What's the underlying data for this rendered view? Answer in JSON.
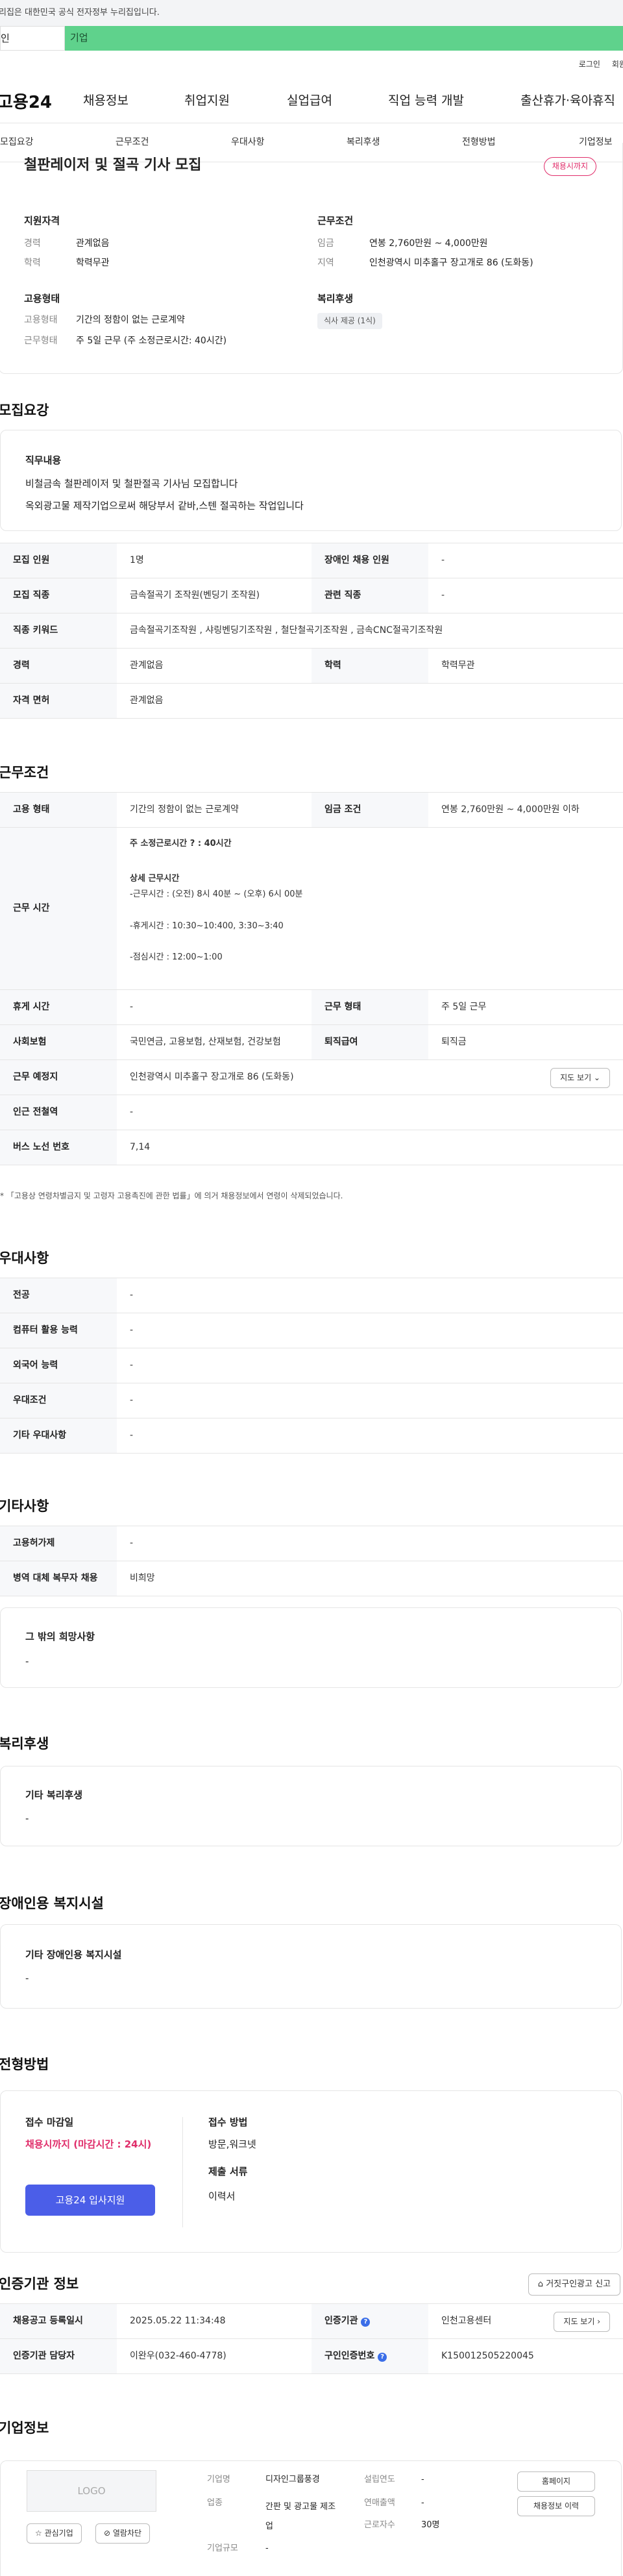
{
  "gov_notice": "리집은 대한민국 공식 전자정부 누리집입니다.",
  "site_tabs": [
    "인",
    "기업"
  ],
  "util": [
    "로그인",
    "회원가"
  ],
  "header": {
    "logo": "고용24",
    "menu": [
      "채용정보",
      "취업지원",
      "실업급여",
      "직업 능력 개발",
      "출산휴가·육아휴직"
    ]
  },
  "tabs": [
    "모집요강",
    "근무조건",
    "우대사항",
    "복리후생",
    "전형방법",
    "기업정보"
  ],
  "summary": {
    "title": "철판레이저 및 절곡 기사 모집",
    "badge": "채용시까지",
    "qual_title": "지원자격",
    "career_label": "경력",
    "career_value": "관계없음",
    "edu_label": "학력",
    "edu_value": "학력무관",
    "cond_title": "근무조건",
    "wage_label": "임금",
    "wage_value": "연봉 2,760만원 ~ 4,000만원",
    "region_label": "지역",
    "region_value": "인천광역시 미추홀구 장고개로 86 (도화동)",
    "emp_title": "고용형태",
    "emptype_label": "고용형태",
    "emptype_value": "기간의 정함이 없는 근로계약",
    "worktype_label": "근무형태",
    "worktype_value": "주 5일 근무 (주 소정근로시간: 40시간)",
    "welfare_title": "복리후생",
    "welfare_chip": "식사 제공 (1식)"
  },
  "recruit": {
    "section_title": "모집요강",
    "duty_title": "직무내용",
    "duty_line1": "비철금속 철판레이저 및 철판절곡 기사님 모집합니다",
    "duty_line2": "옥외광고물 제작기업으로써 해당부서 같바,스텐 절곡하는 작업입니다",
    "rows": [
      [
        "모집 인원",
        "1명",
        "장애인 채용 인원",
        "-"
      ],
      [
        "모집 직종",
        "금속절곡기 조작원(벤딩기 조작원)",
        "관련 직종",
        "-"
      ],
      [
        "직종 키워드",
        "금속절곡기조작원 , 샤링벤딩기조작원 , 철단철곡기조작원 , 금속CNC절곡기조작원"
      ],
      [
        "경력",
        "관계없음",
        "학력",
        "학력무관"
      ],
      [
        "자격 면허",
        "관계없음"
      ]
    ]
  },
  "conditions": {
    "section_title": "근무조건",
    "emp_type_label": "고용 형태",
    "emp_type_value": "기간의 정함이 없는 근로계약",
    "wage_label": "임금 조건",
    "wage_value": "연봉 2,760만원 ~ 4,000만원 이하",
    "hours_label": "근무 시간",
    "hours_main": "주 소정근로시간 ? : 40시간",
    "hours_detail_title": "상세 근무시간",
    "hours_line1": "-근무시간 : (오전) 8시 40분 ~ (오후) 6시 00분",
    "hours_line2": "-휴게시간 : 10:30~10:400, 3:30~3:40",
    "hours_line3": "-점심시간 : 12:00~1:00",
    "rest_label": "휴게 시간",
    "rest_value": "-",
    "worktype_label": "근무 형태",
    "worktype_value": "주 5일 근무",
    "insurance_label": "사회보험",
    "insurance_value": "국민연금, 고용보험, 산재보험, 건강보험",
    "retire_label": "퇴직급여",
    "retire_value": "퇴직금",
    "place_label": "근무 예정지",
    "place_value": "인천광역시 미추홀구 장고개로 86 (도화동)",
    "map_btn": "지도 보기 ⌄",
    "station_label": "인근 전철역",
    "station_value": "-",
    "bus_label": "버스 노선 번호",
    "bus_value": "7,14",
    "note": "* 「고용상 연령차별금지 및 고령자 고용촉진에 관한 법률」에 의거 채용정보에서 연령이 삭제되었습니다."
  },
  "preferences": {
    "section_title": "우대사항",
    "rows": [
      [
        "전공",
        "-"
      ],
      [
        "컴퓨터 활용 능력",
        "-"
      ],
      [
        "외국어 능력",
        "-"
      ],
      [
        "우대조건",
        "-"
      ],
      [
        "기타 우대사항",
        "-"
      ]
    ]
  },
  "others": {
    "section_title": "기타사항",
    "rows": [
      [
        "고용허가제",
        "-"
      ],
      [
        "병역 대체 복무자 채용",
        "비희망"
      ]
    ],
    "etc_title": "그 밖의 희망사항",
    "etc_value": "-"
  },
  "welfare": {
    "section_title": "복리후생",
    "label": "기타 복리후생",
    "value": "-"
  },
  "disabled": {
    "section_title": "장애인용 복지시설",
    "label": "기타 장애인용 복지시설",
    "value": "-"
  },
  "apply": {
    "section_title": "전형방법",
    "deadline_label": "접수 마감일",
    "deadline_value": "채용시까지 (마감시간 : 24시)",
    "button": "고용24 입사지원",
    "method_label": "접수 방법",
    "method_value": "방문,워크넷",
    "docs_label": "제출 서류",
    "docs_value": "이력서"
  },
  "agency": {
    "section_title": "인증기관 정보",
    "report_btn": "거짓구인광고 신고",
    "reg_label": "채용공고 등록일시",
    "reg_value": "2025.05.22 11:34:48",
    "org_label": "인증기관",
    "org_value": "인천고용센터",
    "view_btn": "지도 보기 ›",
    "manager_label": "인증기관 담당자",
    "manager_value": "이완우(032-460-4778)",
    "cert_label": "구인인증번호",
    "cert_value": "K150012505220045"
  },
  "company": {
    "section_title": "기업정보",
    "logo_placeholder": "LOGO",
    "fav_btn": "☆ 관심기업",
    "block_btn": "⊘ 열람차단",
    "name_label": "기업명",
    "name_value": "디자인그룹풍경",
    "industry_label": "업종",
    "industry_value": "간판 및 광고물 제조업",
    "size_label": "기업규모",
    "size_value": "-",
    "founded_label": "설립연도",
    "founded_value": "-",
    "sales_label": "연매출액",
    "sales_value": "-",
    "staff_label": "근로자수",
    "staff_value": "30명",
    "home_btn": "홈페이지",
    "history_btn": "채용정보 이력"
  }
}
